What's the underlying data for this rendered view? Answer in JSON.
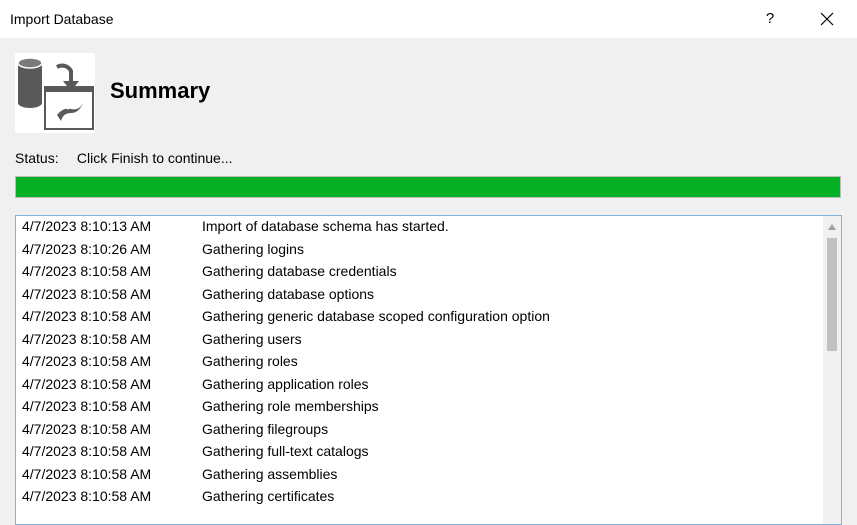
{
  "window": {
    "title": "Import Database",
    "help_label": "?",
    "close_icon": "close-icon"
  },
  "header": {
    "icon": "database-import-icon",
    "title": "Summary"
  },
  "status": {
    "label": "Status:",
    "text": "Click Finish to continue...",
    "progress_percent": 100,
    "progress_color": "#06b025"
  },
  "log": {
    "rows": [
      {
        "time": "4/7/2023 8:10:13 AM",
        "message": "Import of database schema has started."
      },
      {
        "time": "4/7/2023 8:10:26 AM",
        "message": "Gathering logins"
      },
      {
        "time": "4/7/2023 8:10:58 AM",
        "message": "Gathering database credentials"
      },
      {
        "time": "4/7/2023 8:10:58 AM",
        "message": "Gathering database options"
      },
      {
        "time": "4/7/2023 8:10:58 AM",
        "message": "Gathering generic database scoped configuration option"
      },
      {
        "time": "4/7/2023 8:10:58 AM",
        "message": "Gathering users"
      },
      {
        "time": "4/7/2023 8:10:58 AM",
        "message": "Gathering roles"
      },
      {
        "time": "4/7/2023 8:10:58 AM",
        "message": "Gathering application roles"
      },
      {
        "time": "4/7/2023 8:10:58 AM",
        "message": "Gathering role memberships"
      },
      {
        "time": "4/7/2023 8:10:58 AM",
        "message": "Gathering filegroups"
      },
      {
        "time": "4/7/2023 8:10:58 AM",
        "message": "Gathering full-text catalogs"
      },
      {
        "time": "4/7/2023 8:10:58 AM",
        "message": "Gathering assemblies"
      },
      {
        "time": "4/7/2023 8:10:58 AM",
        "message": "Gathering certificates"
      }
    ]
  },
  "colors": {
    "accent_border": "#82b2dc",
    "progress_fill": "#06b025"
  }
}
